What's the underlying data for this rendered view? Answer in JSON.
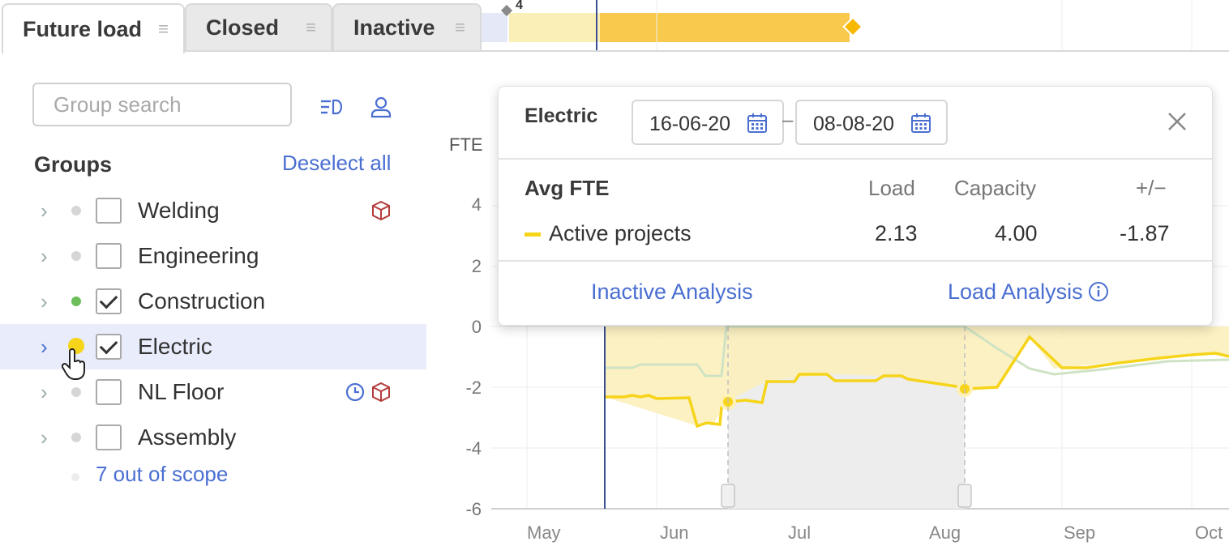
{
  "tabs": [
    {
      "label": "Future load",
      "active": true
    },
    {
      "label": "Closed",
      "active": false
    },
    {
      "label": "Inactive",
      "active": false
    }
  ],
  "left_panel": {
    "search_placeholder": "Group search",
    "groups_title": "Groups",
    "deselect_label": "Deselect all",
    "groups": [
      {
        "label": "Welding",
        "checked": false,
        "dot_color": "#d6d6d6",
        "icons": [
          "cube-icon"
        ]
      },
      {
        "label": "Engineering",
        "checked": false,
        "dot_color": "#d6d6d6",
        "icons": []
      },
      {
        "label": "Construction",
        "checked": true,
        "dot_color": "#6cbf5a",
        "icons": []
      },
      {
        "label": "Electric",
        "checked": true,
        "dot_color": "#f6d41a",
        "selected": true,
        "icons": []
      },
      {
        "label": "NL Floor",
        "checked": false,
        "dot_color": "#d6d6d6",
        "icons": [
          "clock-icon",
          "cube-icon"
        ]
      },
      {
        "label": "Assembly",
        "checked": false,
        "dot_color": "#d6d6d6",
        "icons": []
      }
    ],
    "out_of_scope": "7 out of scope"
  },
  "chart": {
    "y_label": "FTE",
    "y_ticks": [
      "4",
      "2",
      "0",
      "-2",
      "-4",
      "-6"
    ],
    "x_ticks": [
      "May",
      "Jun",
      "Jul",
      "Aug",
      "Sep",
      "Oct"
    ],
    "gantt_label": "4",
    "colors": {
      "active": "#f6d41a",
      "area": "#fbefb8",
      "construction": "#cfe3c4"
    }
  },
  "popup": {
    "title": "Electric",
    "date_from": "16-06-20",
    "date_to": "08-08-20",
    "dash": "–",
    "headers": [
      "Avg FTE",
      "Load",
      "Capacity",
      "+/−"
    ],
    "row": {
      "name": "Active projects",
      "load": "2.13",
      "capacity": "4.00",
      "diff": "-1.87"
    },
    "link_inactive": "Inactive Analysis",
    "link_load": "Load Analysis"
  }
}
